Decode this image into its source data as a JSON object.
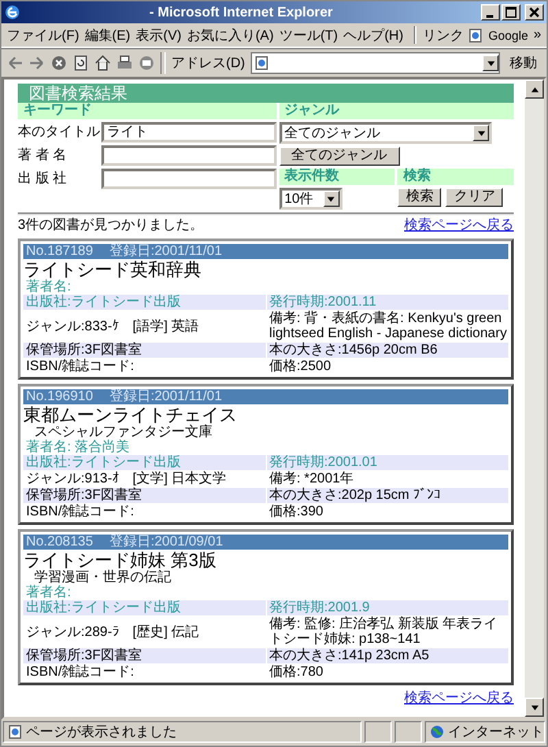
{
  "window": {
    "title": "- Microsoft Internet Explorer"
  },
  "menu": [
    "ファイル(F)",
    "編集(E)",
    "表示(V)",
    "お気に入り(A)",
    "ツール(T)",
    "ヘルプ(H)"
  ],
  "links_bar": {
    "label": "リンク",
    "google": "Google",
    "more": "»"
  },
  "toolbar": {
    "address_label": "アドレス(D)",
    "go": "移動"
  },
  "search_form": {
    "heading": "図書検索結果",
    "keyword_header": "キーワード",
    "fields": [
      {
        "label": "本のタイトル",
        "value": "ライト"
      },
      {
        "label": "著 者 名"
      },
      {
        "label": "出 版 社"
      }
    ],
    "genre_header": "ジャンル",
    "genre_select": "全てのジャンル",
    "genre_button": "全てのジャンル",
    "count_header": "表示件数",
    "count_select": "10件",
    "search_header": "検索",
    "buttons": [
      "検索",
      "クリア"
    ]
  },
  "result_count": "3件の図書が見つかりました。",
  "back_link_top": "検索ページへ戻る",
  "books": [
    {
      "no": "No.187189",
      "registered": "登録日:2001/11/01",
      "title": "ライトシード英和辞典",
      "author": "著者名:",
      "publisher": "出版社:ライトシード出版",
      "published": "発行時期:2001.11",
      "genre": "ジャンル:833-ｹ　[語学] 英語",
      "note": "備考: 背・表紙の書名: Kenkyu's green lightseed English - Japanese dictionary",
      "storage": "保管場所:3F図書室",
      "size": "本の大きさ:1456p 20cm B6",
      "isbn": "ISBN/雑誌コード:",
      "price": "価格:2500"
    },
    {
      "no": "No.196910",
      "registered": "登録日:2001/11/01",
      "title": "東都ムーンライトチェイス",
      "subtitle": "スペシャルファンタジー文庫",
      "author": "著者名: 落合尚美",
      "publisher": "出版社:ライトシード出版",
      "published": "発行時期:2001.01",
      "genre": "ジャンル:913-ｵ　[文学] 日本文学",
      "note": "備考: *2001年",
      "storage": "保管場所:3F図書室",
      "size": "本の大きさ:202p 15cm ﾌﾞﾝｺ",
      "isbn": "ISBN/雑誌コード:",
      "price": "価格:390"
    },
    {
      "no": "No.208135",
      "registered": "登録日:2001/09/01",
      "title": "ライトシード姉妹 第3版",
      "subtitle": "学習漫画・世界の伝記",
      "author": "著者名:",
      "publisher": "出版社:ライトシード出版",
      "published": "発行時期:2001.9",
      "genre": "ジャンル:289-ﾗ　[歴史] 伝記",
      "note": "備考: 監修: 庄治孝弘 新装版 年表ライトシード姉妹: p138~141",
      "storage": "保管場所:3F図書室",
      "size": "本の大きさ:141p 23cm A5",
      "isbn": "ISBN/雑誌コード:",
      "price": "価格:780"
    }
  ],
  "back_link_bottom": "検索ページへ戻る",
  "status_bar": {
    "text": "ページが表示されました",
    "zone": "インターネット"
  }
}
